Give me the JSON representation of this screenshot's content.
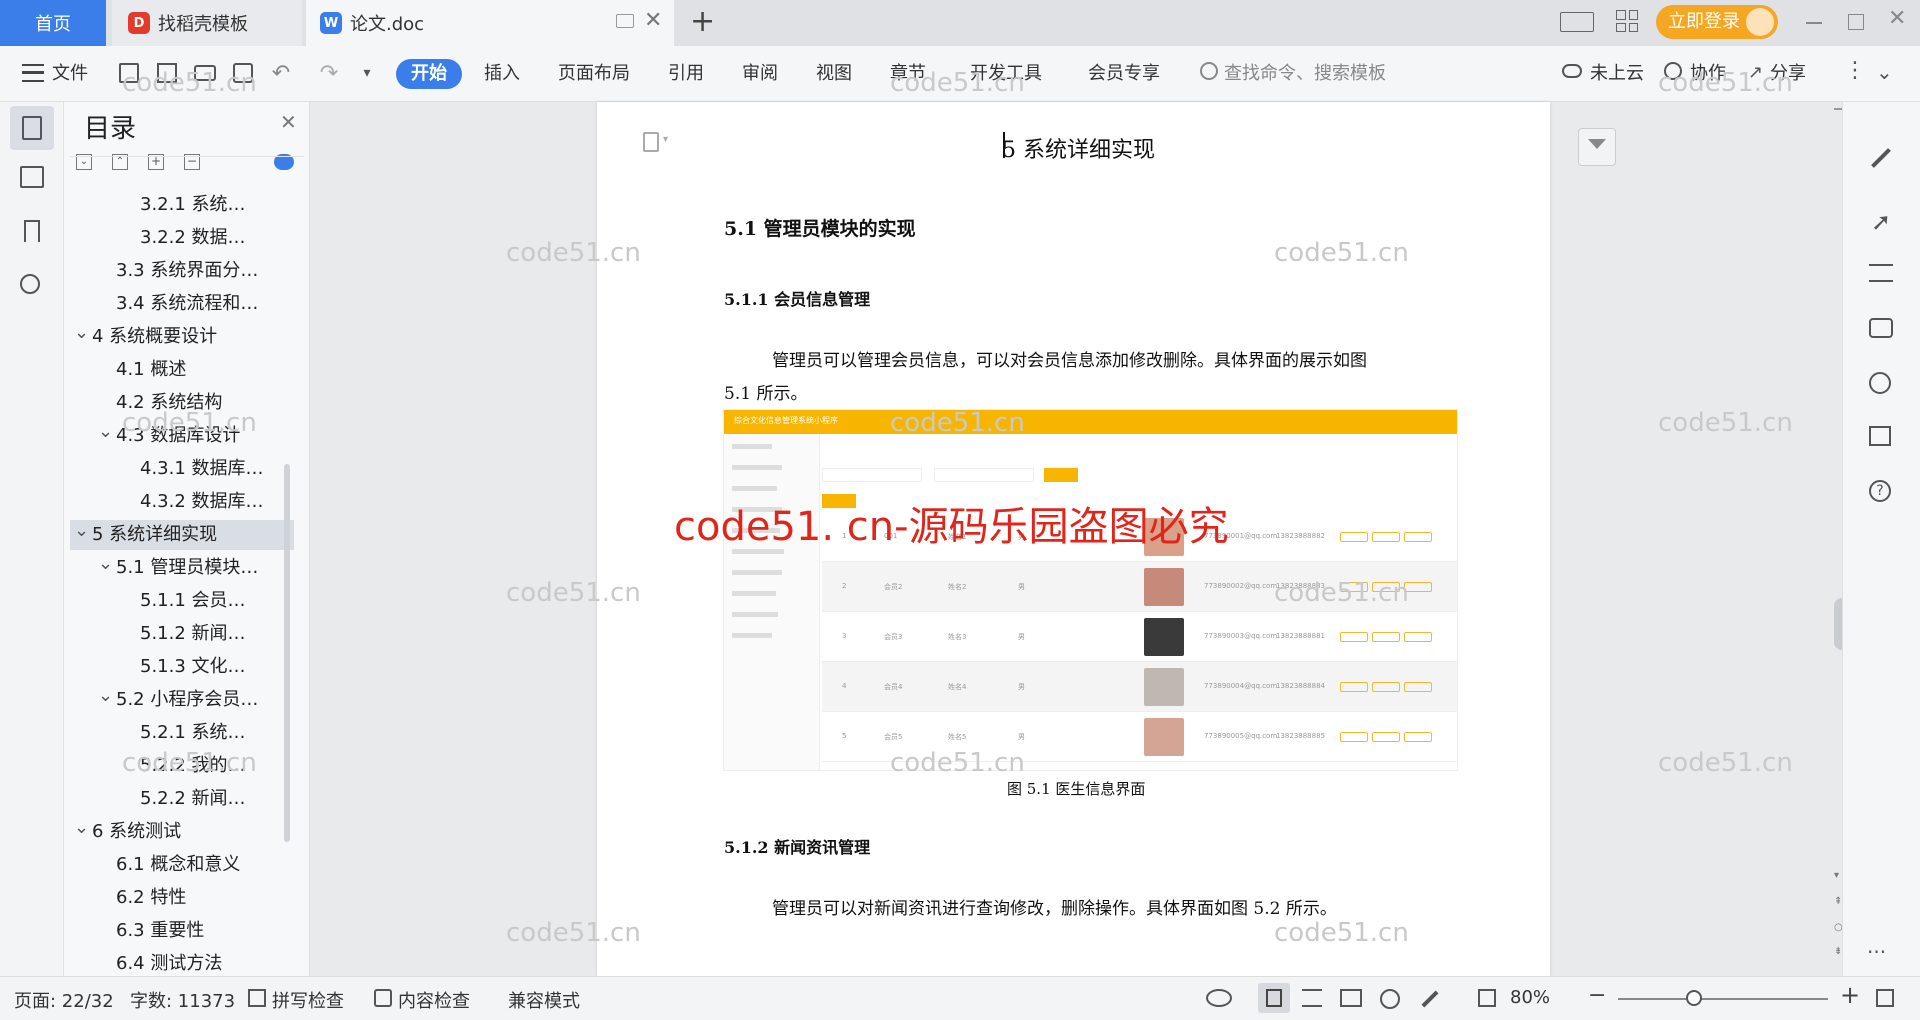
{
  "tabs": {
    "home": "首页",
    "tab1": "找稻壳模板",
    "tab2": "论文.doc",
    "new_tab": "+",
    "login": "立即登录"
  },
  "toolbar": {
    "file": "文件",
    "menus": [
      "开始",
      "插入",
      "页面布局",
      "引用",
      "审阅",
      "视图",
      "章节",
      "开发工具",
      "会员专享"
    ],
    "search_placeholder": "查找命令、搜索模板",
    "cloud": "未上云",
    "collab": "协作",
    "share": "分享"
  },
  "nav": {
    "title": "目录",
    "items": [
      {
        "label": "3.2.1 系统…",
        "level": 3
      },
      {
        "label": "3.2.2 数据…",
        "level": 3
      },
      {
        "label": "3.3 系统界面分…",
        "level": 2
      },
      {
        "label": "3.4 系统流程和…",
        "level": 2
      },
      {
        "label": "4 系统概要设计",
        "level": 1
      },
      {
        "label": "4.1 概述",
        "level": 2
      },
      {
        "label": "4.2 系统结构",
        "level": 2
      },
      {
        "label": "4.3 数据库设计",
        "level": 2
      },
      {
        "label": "4.3.1 数据库…",
        "level": 3
      },
      {
        "label": "4.3.2 数据库…",
        "level": 3
      },
      {
        "label": "5 系统详细实现",
        "level": 1
      },
      {
        "label": "5.1 管理员模块…",
        "level": 2
      },
      {
        "label": "5.1.1 会员…",
        "level": 3
      },
      {
        "label": "5.1.2 新闻…",
        "level": 3
      },
      {
        "label": "5.1.3 文化…",
        "level": 3
      },
      {
        "label": "5.2 小程序会员…",
        "level": 2
      },
      {
        "label": "5.2.1 系统…",
        "level": 3
      },
      {
        "label": "5.2.2 我的…",
        "level": 3
      },
      {
        "label": "5.2.2 新闻…",
        "level": 3
      },
      {
        "label": "6 系统测试",
        "level": 1
      },
      {
        "label": "6.1 概念和意义",
        "level": 2
      },
      {
        "label": "6.2 特性",
        "level": 2
      },
      {
        "label": "6.3 重要性",
        "level": 2
      },
      {
        "label": "6.4 测试方法",
        "level": 2
      }
    ]
  },
  "doc": {
    "chapter": "5 系统详细实现",
    "h2": "5.1  管理员模块的实现",
    "h3a": "5.1.1  会员信息管理",
    "p1a": "管理员可以管理会员信息，可以对会员信息添加修改删除。具体界面的展示如图",
    "p1b": "5.1 所示。",
    "caption": "图 5.1  医生信息界面",
    "h3b": "5.1.2  新闻资讯管理",
    "p2": "管理员可以对新闻资讯进行查询修改，删除操作。具体界面如图 5.2 所示。",
    "figure": {
      "title": "综合文化信息管理系统小程序",
      "rows": [
        {
          "no": "1",
          "name": "001",
          "nick": "姓名1",
          "sex": "男",
          "email": "773890001@qq.com",
          "phone": "13823888882"
        },
        {
          "no": "2",
          "name": "会员2",
          "nick": "姓名2",
          "sex": "男",
          "email": "773890002@qq.com",
          "phone": "13823888883"
        },
        {
          "no": "3",
          "name": "会员3",
          "nick": "姓名3",
          "sex": "男",
          "email": "773890003@qq.com",
          "phone": "13823888881"
        },
        {
          "no": "4",
          "name": "会员4",
          "nick": "姓名4",
          "sex": "男",
          "email": "773890004@qq.com",
          "phone": "13823888884"
        },
        {
          "no": "5",
          "name": "会员5",
          "nick": "姓名5",
          "sex": "男",
          "email": "773890005@qq.com",
          "phone": "13823888885"
        }
      ]
    }
  },
  "watermark": "code51.cn",
  "overlay": "code51. cn-源码乐园盗图必究",
  "status": {
    "page": "页面: 22/32",
    "words": "字数: 11373",
    "spell": "拼写检查",
    "content": "内容检查",
    "compat": "兼容模式",
    "zoom": "80%"
  },
  "colors": {
    "accent": "#3b7de9",
    "login": "#f5a623",
    "overlay": "#e1251b",
    "figure_bar": "#f7b500"
  }
}
